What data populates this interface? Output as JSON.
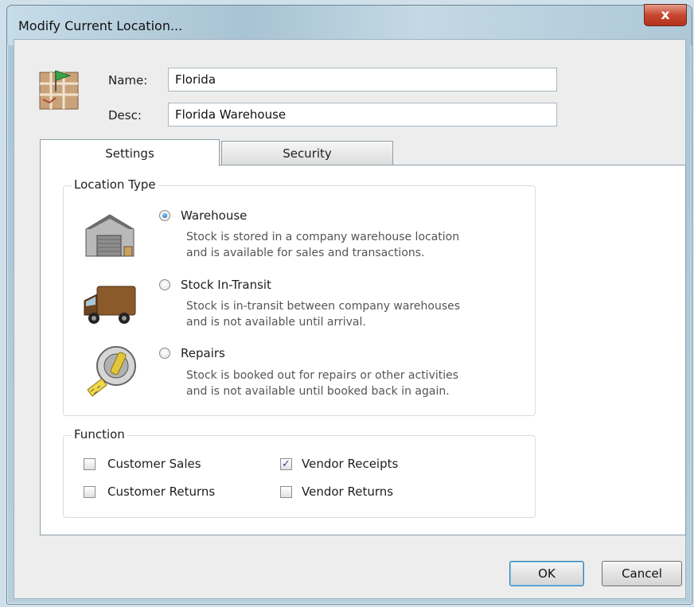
{
  "window": {
    "title": "Modify Current Location...",
    "close_glyph": "x"
  },
  "header": {
    "icon": "map-location-flag-icon",
    "name_label": "Name:",
    "name_value": "Florida",
    "desc_label": "Desc:",
    "desc_value": "Florida Warehouse"
  },
  "tabs": [
    {
      "label": "Settings",
      "selected": true
    },
    {
      "label": "Security",
      "selected": false
    }
  ],
  "location_type": {
    "legend": "Location Type",
    "options": [
      {
        "label": "Warehouse",
        "selected": true,
        "icon": "warehouse-icon",
        "desc_line1": "Stock is stored in a company warehouse location",
        "desc_line2": "and is available for sales and transactions."
      },
      {
        "label": "Stock In-Transit",
        "selected": false,
        "icon": "delivery-truck-icon",
        "desc_line1": "Stock is in-transit between company warehouses",
        "desc_line2": "and is not available until arrival."
      },
      {
        "label": "Repairs",
        "selected": false,
        "icon": "tape-measure-icon",
        "desc_line1": "Stock is booked out for repairs or other activities",
        "desc_line2": "and is not available until booked back in again."
      }
    ]
  },
  "function": {
    "legend": "Function",
    "items": [
      {
        "label": "Customer Sales",
        "checked": false
      },
      {
        "label": "Vendor Receipts",
        "checked": true
      },
      {
        "label": "Customer Returns",
        "checked": false
      },
      {
        "label": "Vendor Returns",
        "checked": false
      }
    ]
  },
  "buttons": {
    "ok": "OK",
    "cancel": "Cancel"
  },
  "colors": {
    "accent": "#1e6fb8",
    "close_red": "#c7472f"
  }
}
